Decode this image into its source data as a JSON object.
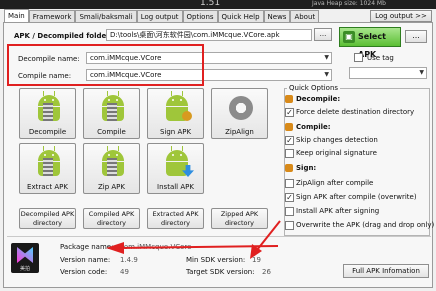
{
  "titlebar": {
    "title": "1.51",
    "heap": "Java Heap size:     1024 Mb"
  },
  "tabs": [
    {
      "label": "Main",
      "active": true
    },
    {
      "label": "Framework"
    },
    {
      "label": "Smali/baksmali"
    },
    {
      "label": "Log output"
    },
    {
      "label": "Options"
    },
    {
      "label": "Quick Help"
    },
    {
      "label": "News"
    },
    {
      "label": "About"
    }
  ],
  "log_output_button": "Log output >>",
  "apk_folder": {
    "label": "APK / Decompiled folder:",
    "value": "D:\\tools\\桌面\\河东软件园\\com.iMMcque.VCore.apk",
    "browse": "..."
  },
  "select_apk": {
    "label": "Select APK",
    "extra": "..."
  },
  "use_tag": {
    "label": "Use tag",
    "checked": false,
    "value": ""
  },
  "decompile_name": {
    "label": "Decompile name:",
    "value": "com.iMMcque.VCore"
  },
  "compile_name": {
    "label": "Compile name:",
    "value": "com.iMMcque.VCore"
  },
  "tiles": [
    {
      "label": "Decompile",
      "icon": "android-zipper-icon"
    },
    {
      "label": "Compile",
      "icon": "android-zipper-icon"
    },
    {
      "label": "Sign APK",
      "icon": "android-key-icon"
    },
    {
      "label": "ZipAlign",
      "icon": "gear-icon"
    },
    {
      "label": "Extract APK",
      "icon": "android-zipper-icon"
    },
    {
      "label": "Zip APK",
      "icon": "android-zipper-icon"
    },
    {
      "label": "Install APK",
      "icon": "android-arrow-icon"
    }
  ],
  "dir_buttons": [
    "Decompiled APK directory",
    "Compiled APK directory",
    "Extracted APK directory",
    "Zipped APK directory"
  ],
  "quick_options": {
    "title": "Quick Options",
    "decompile_header": "Decompile:",
    "compile_header": "Compile:",
    "sign_header": "Sign:",
    "items": [
      {
        "label": "Force delete destination directory",
        "checked": true
      },
      {
        "label": "Skip changes detection",
        "checked": true
      },
      {
        "label": "Keep original signature",
        "checked": false
      },
      {
        "label": "ZipAlign after compile",
        "checked": false
      },
      {
        "label": "Sign APK after compile (overwrite)",
        "checked": true
      },
      {
        "label": "Install APK after signing",
        "checked": false
      },
      {
        "label": "Overwrite the APK (drag and drop only)",
        "checked": false
      }
    ]
  },
  "app_info": {
    "icon_text": "美拍",
    "package_name_label": "Package name:",
    "package_name_value": "com.iMMcque.VCore",
    "version_name_label": "Version name:",
    "version_name_value": "1.4.9",
    "version_code_label": "Version code:",
    "version_code_value": "49",
    "min_sdk_label": "Min SDK version:",
    "min_sdk_value": "19",
    "target_sdk_label": "Target SDK version:",
    "target_sdk_value": "26",
    "full_info_button": "Full APK Infomation"
  },
  "colors": {
    "annotation": "#e02020",
    "select_green": "#5bbf34",
    "android_green": "#9fc63a"
  }
}
